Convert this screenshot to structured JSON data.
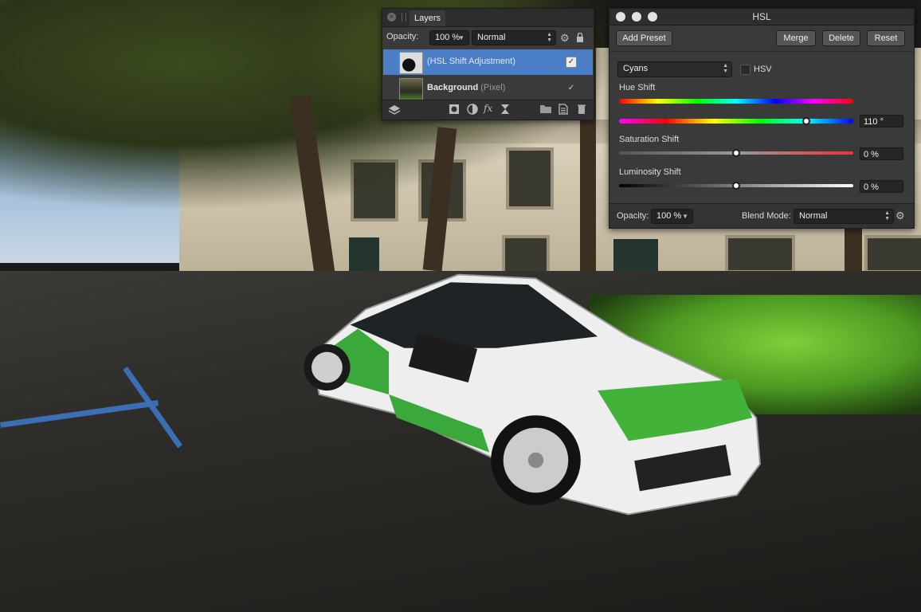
{
  "layers_panel": {
    "tab_title": "Layers",
    "opacity_label": "Opacity:",
    "opacity_value": "100 %",
    "blend_mode": "Normal",
    "layers": [
      {
        "name": "(HSL Shift Adjustment)",
        "selected": true,
        "visible": true
      },
      {
        "name_bold": "Background",
        "name_suffix": " (Pixel)",
        "selected": false,
        "visible": true
      }
    ],
    "footer_icons": [
      "layers-stack-icon",
      "mask-icon",
      "adjustment-icon",
      "fx-icon",
      "hourglass-icon",
      "folder-icon",
      "new-layer-icon",
      "trash-icon"
    ],
    "fx_glyph": "fx"
  },
  "hsl_panel": {
    "title": "HSL",
    "buttons": {
      "add_preset": "Add Preset",
      "merge": "Merge",
      "delete": "Delete",
      "reset": "Reset"
    },
    "channel_select": "Cyans",
    "hsv_label": "HSV",
    "hue_shift_label": "Hue Shift",
    "hue_shift_value": "110 °",
    "hue_shift_fraction": 0.8,
    "saturation_shift_label": "Saturation Shift",
    "saturation_shift_value": "0 %",
    "saturation_fraction": 0.5,
    "luminosity_shift_label": "Luminosity Shift",
    "luminosity_shift_value": "0 %",
    "luminosity_fraction": 0.5,
    "opacity_label": "Opacity:",
    "opacity_value": "100 %",
    "blend_mode_label": "Blend Mode:",
    "blend_mode_value": "Normal"
  },
  "colors": {
    "selection": "#4a7fc7",
    "panel_bg": "#3a3a3a"
  }
}
